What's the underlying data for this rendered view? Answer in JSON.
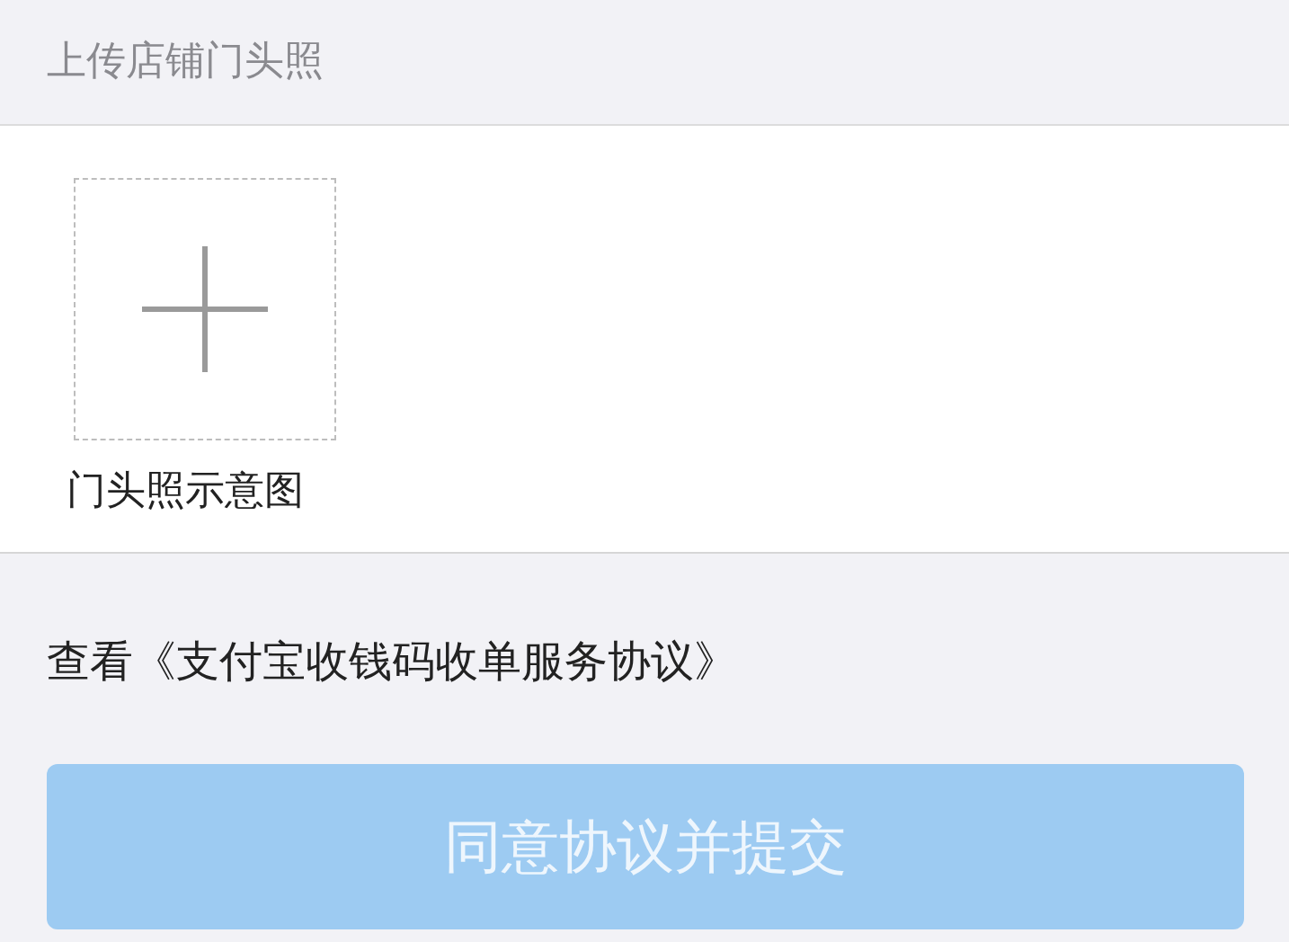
{
  "section_header": {
    "title": "上传店铺门头照"
  },
  "upload": {
    "caption": "门头照示意图"
  },
  "agreement": {
    "text": "查看《支付宝收钱码收单服务协议》"
  },
  "submit_button": {
    "label": "同意协议并提交",
    "disabled": true
  }
}
